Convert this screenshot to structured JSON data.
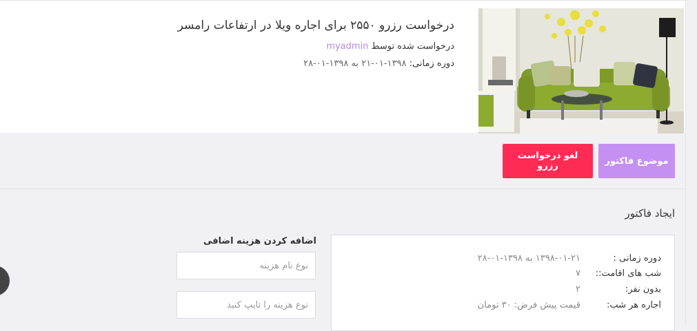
{
  "request": {
    "title": "درخواست رزرو ۲۵۵۰ برای اجاره ویلا در ارتفاعات رامسر",
    "requested_by_label": "درخواست شده توسط",
    "requested_by_user": "myadmin",
    "period_label": "دوره زمانی:",
    "period_value": "۱۳۹۸-۰۱-۲۱ به ۱۳۹۸-۰۱-۲۸"
  },
  "actions": {
    "invoice_label": "موضوع فاکتور",
    "cancel_label": "لغو درخواست رزرو"
  },
  "invoice": {
    "heading": "ایجاد فاکتور",
    "rows": [
      {
        "label": "دوره زمانی :",
        "value": "۱۳۹۸-۰۱-۲۱ به ۱۳۹۸-۰۱-۲۸"
      },
      {
        "label": "شب های اقامت::",
        "value": "۷"
      },
      {
        "label": "بدون نفر:",
        "value": "۲"
      },
      {
        "label": "اجاره هر شب:",
        "value": "قیمت پیش فرض: ۳۰ تومان"
      }
    ]
  },
  "extra_cost": {
    "heading": "اضافه کردن هزینه اضافی",
    "name_placeholder": "نوع نام هزینه",
    "type_placeholder": "نوع هزینه را تایپ کنید"
  },
  "colors": {
    "invoice_button": "#c490f2",
    "cancel_button": "#fe2c55",
    "username": "#b58ae0"
  }
}
